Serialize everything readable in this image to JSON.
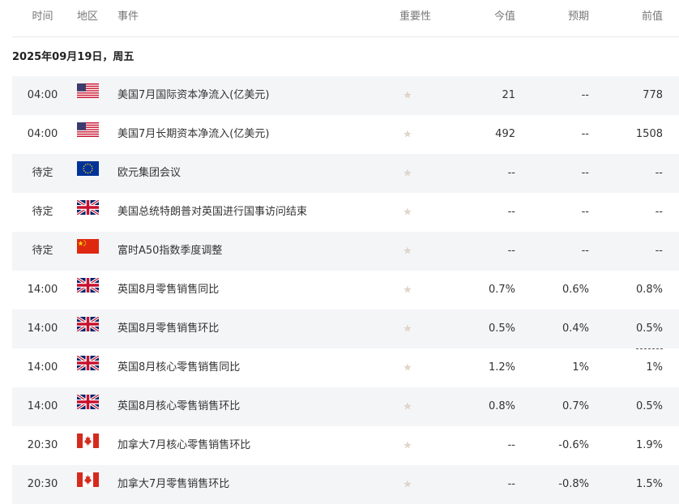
{
  "header": {
    "time": "时间",
    "region": "地区",
    "event": "事件",
    "importance": "重要性",
    "actual": "今值",
    "forecast": "预期",
    "previous": "前值"
  },
  "date": "2025年09月19日，周五",
  "importance_colors": {
    "on": "#f08a24",
    "off": "#d9d9d9"
  },
  "rows": [
    {
      "time": "04:00",
      "flag": "us-flag-icon",
      "event": "美国7月国际资本净流入(亿美元)",
      "stars": 2,
      "actual": "21",
      "forecast": "--",
      "previous": "778",
      "previous_revised": false
    },
    {
      "time": "04:00",
      "flag": "us-flag-icon",
      "event": "美国7月长期资本净流入(亿美元)",
      "stars": 2,
      "actual": "492",
      "forecast": "--",
      "previous": "1508",
      "previous_revised": false
    },
    {
      "time": "待定",
      "flag": "eu-flag-icon",
      "event": "欧元集团会议",
      "stars": 2,
      "actual": "--",
      "forecast": "--",
      "previous": "--",
      "previous_revised": false
    },
    {
      "time": "待定",
      "flag": "uk-flag-icon",
      "event": "美国总统特朗普对英国进行国事访问结束",
      "stars": 2,
      "actual": "--",
      "forecast": "--",
      "previous": "--",
      "previous_revised": false
    },
    {
      "time": "待定",
      "flag": "cn-flag-icon",
      "event": "富时A50指数季度调整",
      "stars": 2,
      "actual": "--",
      "forecast": "--",
      "previous": "--",
      "previous_revised": false
    },
    {
      "time": "14:00",
      "flag": "uk-flag-icon",
      "event": "英国8月零售销售同比",
      "stars": 2,
      "actual": "0.7%",
      "forecast": "0.6%",
      "previous": "0.8%",
      "previous_revised": true
    },
    {
      "time": "14:00",
      "flag": "uk-flag-icon",
      "event": "英国8月零售销售环比",
      "stars": 2,
      "actual": "0.5%",
      "forecast": "0.4%",
      "previous": "0.5%",
      "previous_revised": true
    },
    {
      "time": "14:00",
      "flag": "uk-flag-icon",
      "event": "英国8月核心零售销售同比",
      "stars": 2,
      "actual": "1.2%",
      "forecast": "1%",
      "previous": "1%",
      "previous_revised": true
    },
    {
      "time": "14:00",
      "flag": "uk-flag-icon",
      "event": "英国8月核心零售销售环比",
      "stars": 2,
      "actual": "0.8%",
      "forecast": "0.7%",
      "previous": "0.5%",
      "previous_revised": false
    },
    {
      "time": "20:30",
      "flag": "ca-flag-icon",
      "event": "加拿大7月核心零售销售环比",
      "stars": 2,
      "actual": "--",
      "forecast": "-0.6%",
      "previous": "1.9%",
      "previous_revised": false
    },
    {
      "time": "20:30",
      "flag": "ca-flag-icon",
      "event": "加拿大7月零售销售环比",
      "stars": 2,
      "actual": "--",
      "forecast": "-0.8%",
      "previous": "1.5%",
      "previous_revised": false
    }
  ]
}
